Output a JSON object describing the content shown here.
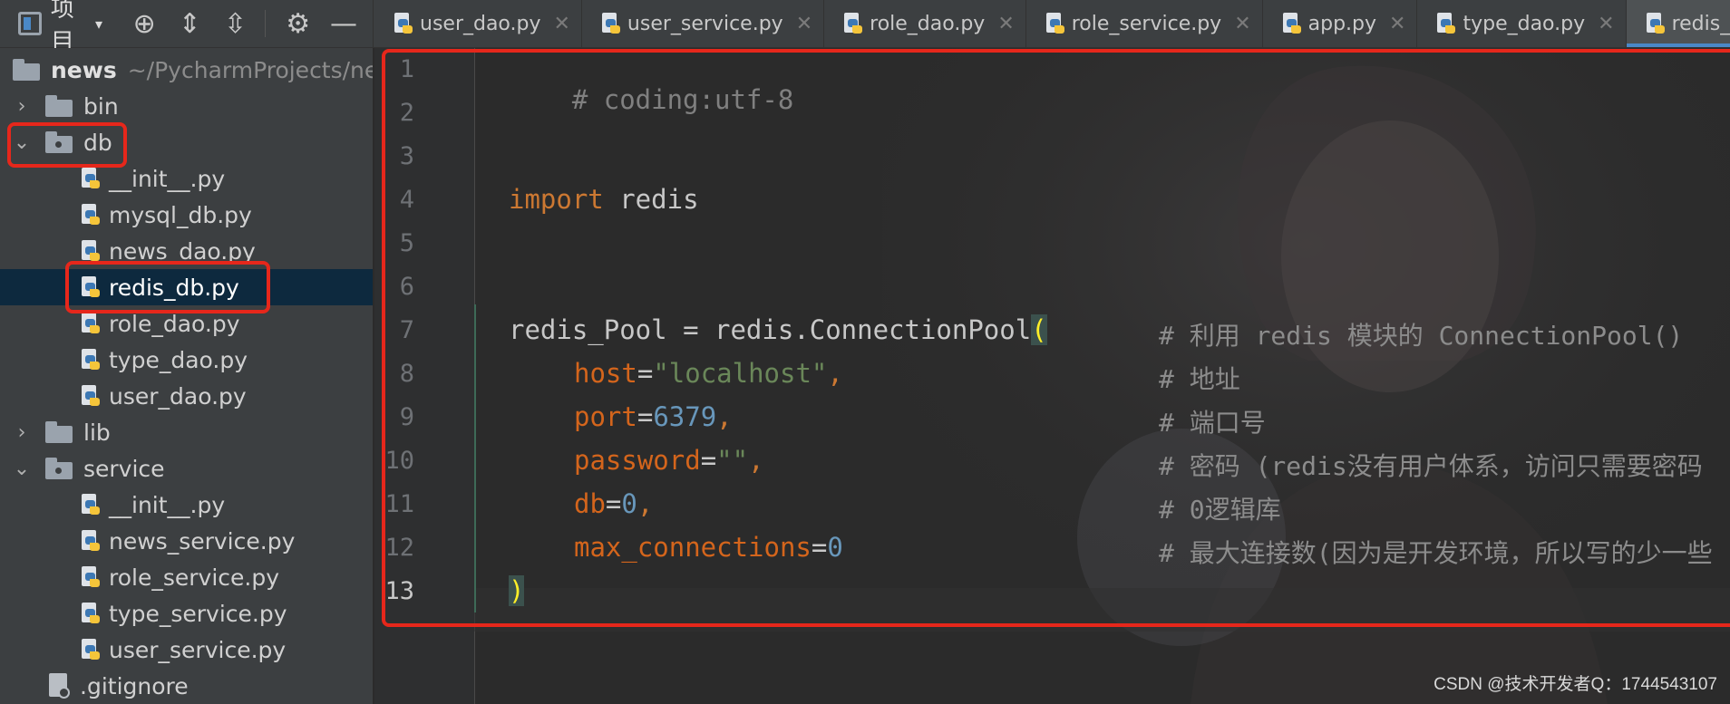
{
  "toolbar": {
    "project_label": "项目",
    "icons": [
      "project-tool-window-icon",
      "dropdown-caret-icon",
      "locate-icon",
      "expand-all-icon",
      "collapse-all-icon",
      "gear-icon",
      "hide-icon"
    ]
  },
  "tabs": [
    {
      "label": "user_dao.py",
      "active": false
    },
    {
      "label": "user_service.py",
      "active": false
    },
    {
      "label": "role_dao.py",
      "active": false
    },
    {
      "label": "role_service.py",
      "active": false
    },
    {
      "label": "app.py",
      "active": false
    },
    {
      "label": "type_dao.py",
      "active": false
    },
    {
      "label": "redis_db",
      "active": true
    }
  ],
  "tree": {
    "root": {
      "name": "news",
      "path": "~/PycharmProjects/new"
    },
    "items": [
      {
        "label": "bin",
        "kind": "folder",
        "state": "collapsed"
      },
      {
        "label": "db",
        "kind": "package",
        "state": "expanded"
      },
      {
        "label": "__init__.py",
        "kind": "python-file"
      },
      {
        "label": "mysql_db.py",
        "kind": "python-file"
      },
      {
        "label": "news_dao.py",
        "kind": "python-file"
      },
      {
        "label": "redis_db.py",
        "kind": "python-file",
        "selected": true
      },
      {
        "label": "role_dao.py",
        "kind": "python-file"
      },
      {
        "label": "type_dao.py",
        "kind": "python-file"
      },
      {
        "label": "user_dao.py",
        "kind": "python-file"
      },
      {
        "label": "lib",
        "kind": "folder",
        "state": "collapsed"
      },
      {
        "label": "service",
        "kind": "package",
        "state": "expanded"
      },
      {
        "label": "__init__.py",
        "kind": "python-file"
      },
      {
        "label": "news_service.py",
        "kind": "python-file"
      },
      {
        "label": "role_service.py",
        "kind": "python-file"
      },
      {
        "label": "type_service.py",
        "kind": "python-file"
      },
      {
        "label": "user_service.py",
        "kind": "python-file"
      },
      {
        "label": ".gitignore",
        "kind": "git-file"
      }
    ]
  },
  "editor": {
    "line_numbers": [
      "1",
      "2",
      "3",
      "4",
      "5",
      "6",
      "7",
      "8",
      "9",
      "10",
      "11",
      "12",
      "13"
    ],
    "current_line": "13",
    "lines": {
      "l1": {
        "comment": "# coding:utf-8"
      },
      "l4": {
        "kw": "import",
        "module": " redis"
      },
      "l7": {
        "name": "redis_Pool",
        "op": " = ",
        "call": "redis.ConnectionPool",
        "paren": "("
      },
      "l8": {
        "param": "host",
        "eq": "=",
        "value": "\"localhost\"",
        "comma": ","
      },
      "l9": {
        "param": "port",
        "eq": "=",
        "value": "6379",
        "comma": ","
      },
      "l10": {
        "param": "password",
        "eq": "=",
        "value": "\"\"",
        "comma": ","
      },
      "l11": {
        "param": "db",
        "eq": "=",
        "value": "0",
        "comma": ","
      },
      "l12": {
        "param": "max_connections",
        "eq": "=",
        "value": "0"
      },
      "l13": {
        "paren": ")"
      }
    },
    "comments": {
      "c7": "# 利用 redis 模块的 ConnectionPool()",
      "c8": "# 地址",
      "c9": "# 端口号",
      "c10": "# 密码 (redis没有用户体系，访问只需要密码",
      "c11": "# 0逻辑库",
      "c12": "# 最大连接数(因为是开发环境，所以写的少一些"
    }
  },
  "watermark": "CSDN @技术开发者Q：1744543107",
  "colors": {
    "highlight_box": "#e6271b",
    "keyword": "#cc7832",
    "string": "#6a8759",
    "number": "#6897bb",
    "comment": "#808080",
    "selection": "#0d293e"
  }
}
